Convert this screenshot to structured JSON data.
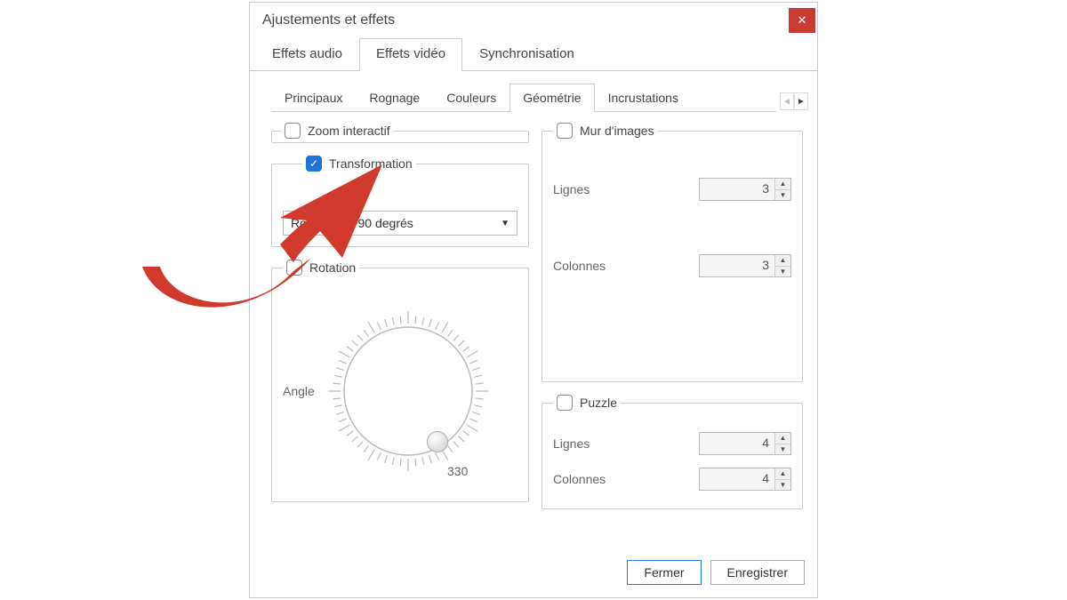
{
  "window": {
    "title": "Ajustements et effets"
  },
  "tabs": {
    "items": [
      {
        "label": "Effets audio"
      },
      {
        "label": "Effets vidéo"
      },
      {
        "label": "Synchronisation"
      }
    ],
    "active": 1
  },
  "subtabs": {
    "items": [
      {
        "label": "Principaux"
      },
      {
        "label": "Rognage"
      },
      {
        "label": "Couleurs"
      },
      {
        "label": "Géométrie"
      },
      {
        "label": "Incrustations"
      }
    ],
    "active": 3
  },
  "zoom_group": {
    "label": "Zoom interactif",
    "checked": false
  },
  "transformation_group": {
    "label": "Transformation",
    "checked": true,
    "option": "Rotation de 90 degrés"
  },
  "rotation_group": {
    "label": "Rotation",
    "checked": false,
    "angle_label": "Angle",
    "tick_label": "330"
  },
  "wall_group": {
    "label": "Mur d'images",
    "checked": false,
    "rows_label": "Lignes",
    "rows_value": "3",
    "cols_label": "Colonnes",
    "cols_value": "3"
  },
  "puzzle_group": {
    "label": "Puzzle",
    "checked": false,
    "rows_label": "Lignes",
    "rows_value": "4",
    "cols_label": "Colonnes",
    "cols_value": "4"
  },
  "footer": {
    "close": "Fermer",
    "save": "Enregistrer"
  }
}
